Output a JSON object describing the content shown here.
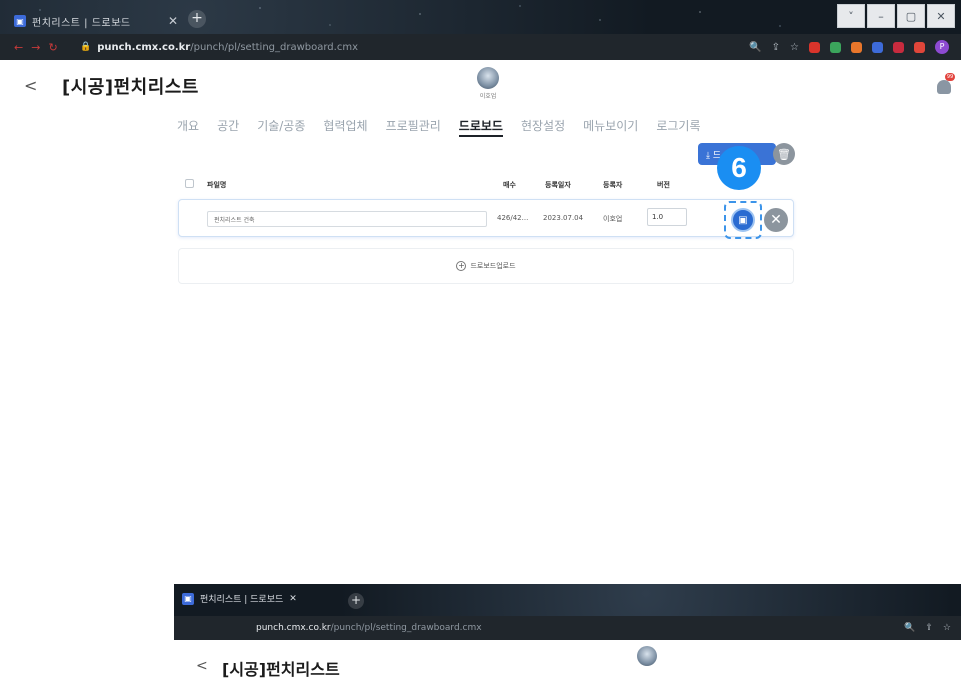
{
  "browser": {
    "tab_title": "펀치리스트 | 드로보드",
    "tab_close": "✕",
    "new_tab": "+",
    "url_host": "punch.cmx.co.kr",
    "url_path": "/punch/pl/setting_drawboard.cmx",
    "window_controls": [
      "˅",
      "–",
      "▢",
      "✕"
    ],
    "profile_initial": "P"
  },
  "header": {
    "back_label": "<",
    "title": "[시공]펀치리스트",
    "logo_caption": "이호업",
    "bell_badge": "99"
  },
  "menu": {
    "items": [
      "개요",
      "공간",
      "기술/공종",
      "협력업체",
      "프로필관리",
      "드로보드",
      "현장설정",
      "메뉴보이기",
      "로그기록"
    ],
    "active_index": 5
  },
  "actions": {
    "download_label": "⤓ 드",
    "trash_icon": "🗑"
  },
  "step_badge": "6",
  "table": {
    "headers": {
      "filename": "파일명",
      "pages": "매수",
      "date": "등록일자",
      "registrant": "등록자",
      "version": "버전"
    },
    "rows": [
      {
        "filename": "펀치리스트 건축",
        "pages": "426/42...",
        "date": "2023.07.04",
        "registrant": "이호업",
        "version": "1.0"
      }
    ]
  },
  "upload": {
    "label": "드로보드업로드"
  },
  "colors": {
    "accent": "#3a73d6",
    "highlight": "#3c94e9",
    "badge": "#1a8ef2"
  }
}
